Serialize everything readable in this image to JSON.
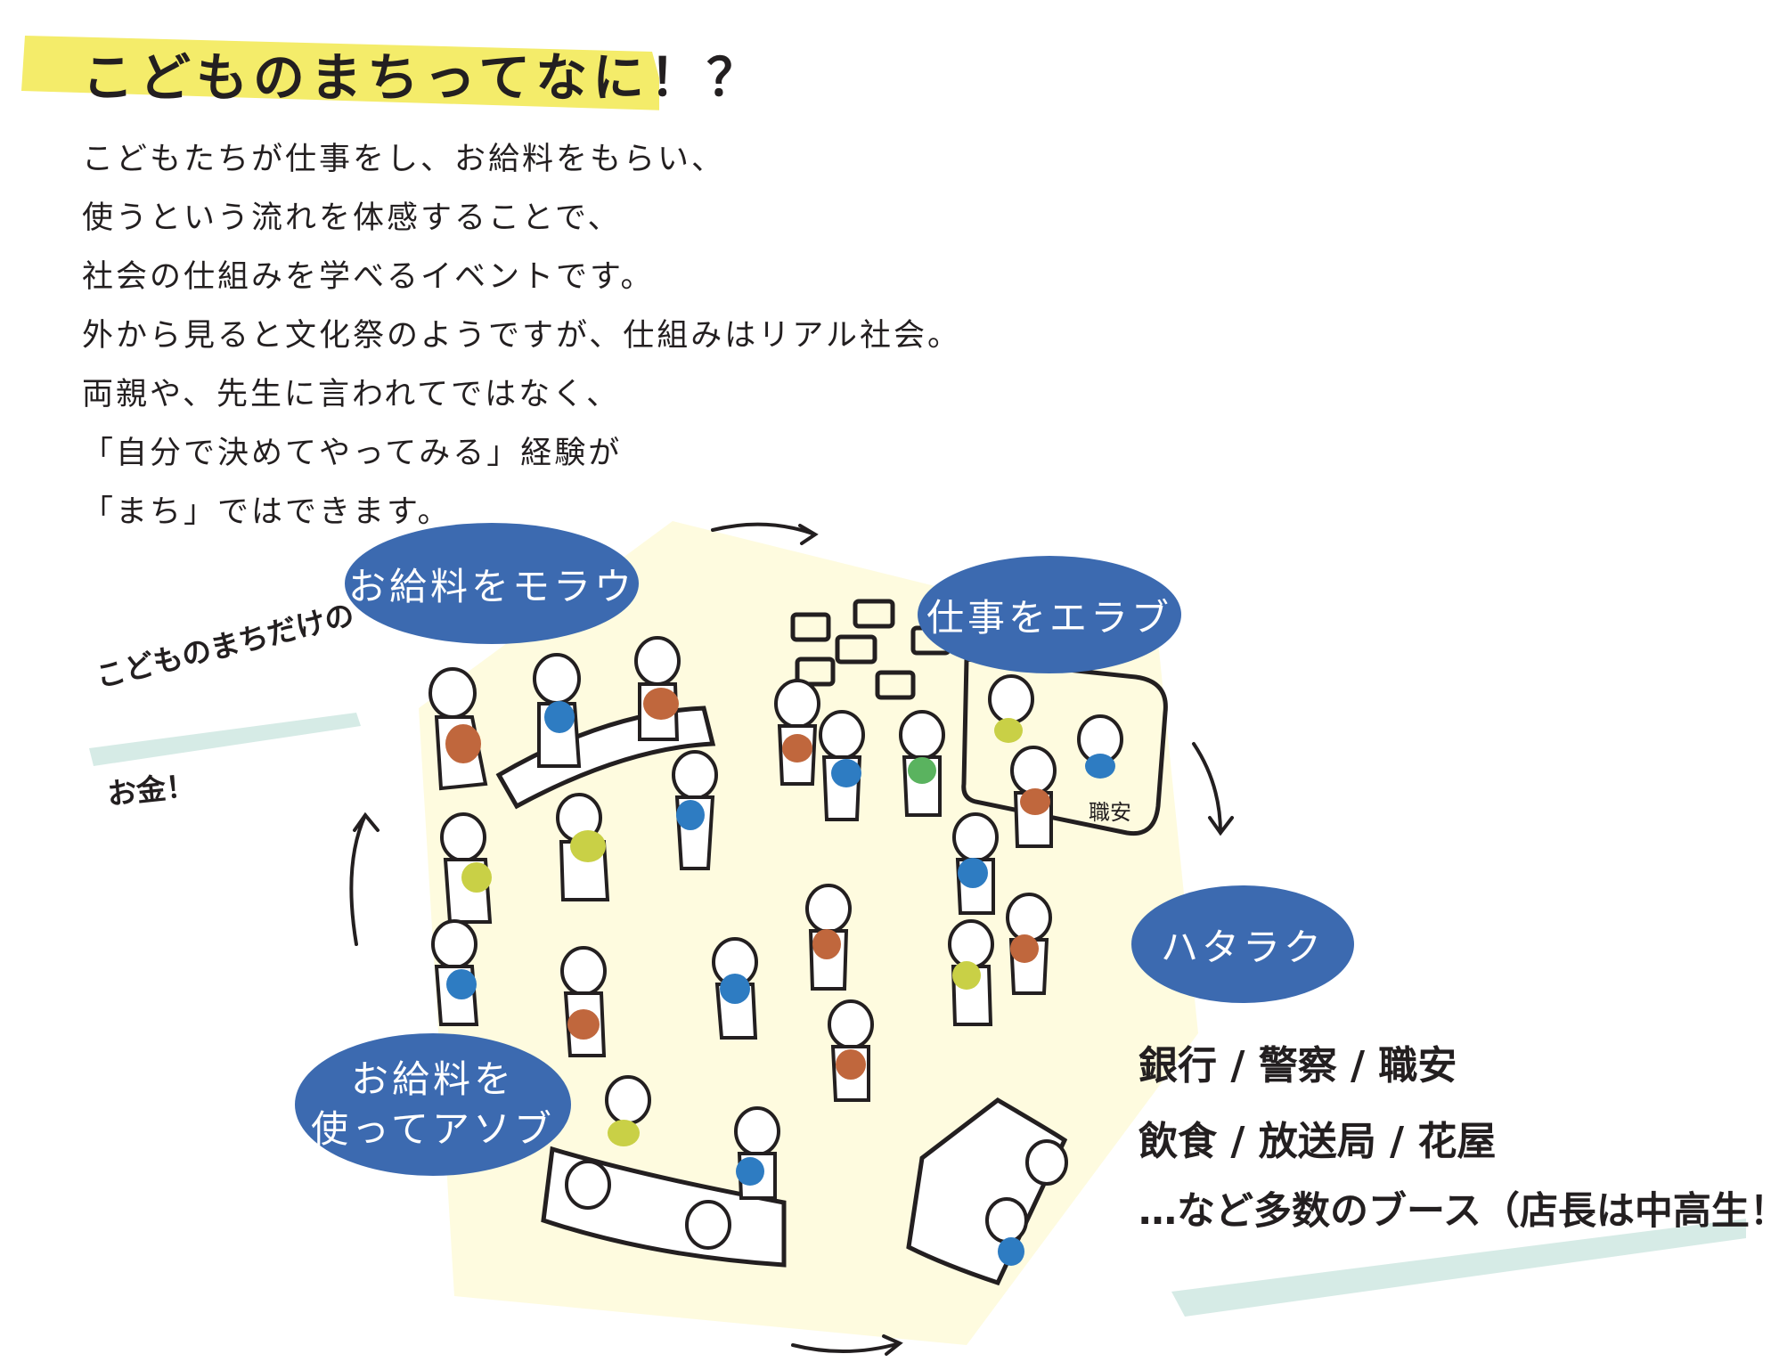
{
  "title": "こどものまちってなに！？",
  "intro": [
    "こどもたちが仕事をし、お給料をもらい、",
    "使うという流れを体感することで、",
    "社会の仕組みを学べるイベントです。",
    "外から見ると文化祭のようですが、仕組みはリアル社会。",
    "両親や、先生に言われてではなく、",
    "「自分で決めてやってみる」経験が",
    "「まち」ではできます。"
  ],
  "bubbles": {
    "get_salary": "お給料をモラウ",
    "choose_job": "仕事をエラブ",
    "work": "ハタラク",
    "use_salary_1": "お給料を",
    "use_salary_2": "使ってアソブ"
  },
  "note": {
    "line1": "こどものまちだけの",
    "line2": "お金！"
  },
  "sign": "職安",
  "booths": {
    "line1": "銀行 / 警察 / 職安",
    "line2": "飲食 / 放送局 / 花屋",
    "line3": "…など多数のブース（店長は中高生！）"
  },
  "colors": {
    "highlight_yellow": "#f4ec6a",
    "bubble_blue": "#3c6ab0",
    "background_cream": "#fefbdf",
    "underline_mint": "#d6ebe6",
    "shirt_orange": "#c0673d",
    "shirt_blue": "#2e7cc2",
    "shirt_lime": "#c9d046",
    "shirt_green": "#5ab35f"
  }
}
